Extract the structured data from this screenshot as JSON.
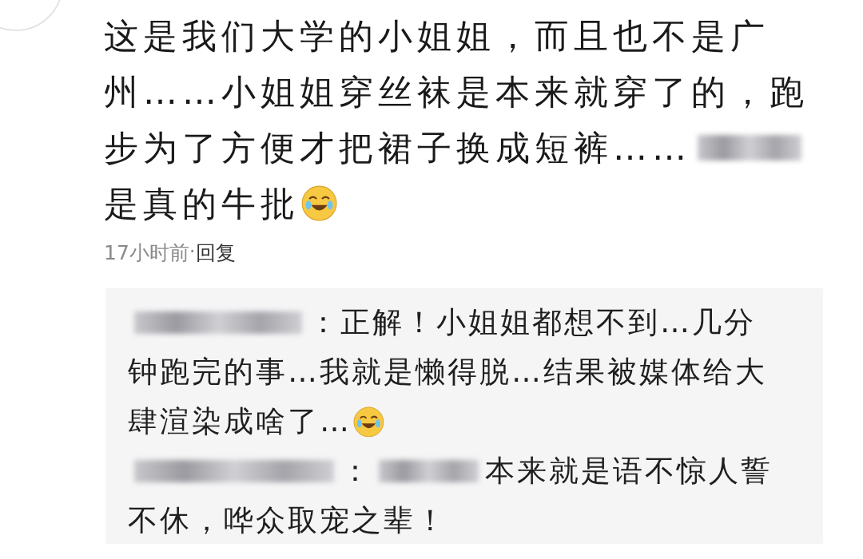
{
  "comment": {
    "lines": [
      [
        {
          "kind": "text",
          "text": "这是我们大学的小姐姐，而且也不是广"
        }
      ],
      [
        {
          "kind": "text",
          "text": "州……小姐姐穿丝袜是本来就穿了的，跑"
        }
      ],
      [
        {
          "kind": "text",
          "text": "步为了方便才把裙子换成短裤……"
        },
        {
          "kind": "redacted"
        }
      ],
      [
        {
          "kind": "text",
          "text": "是真的牛批"
        },
        {
          "kind": "emoji"
        }
      ]
    ],
    "time": "17小时前",
    "separator": "·",
    "reply_action": "回复"
  },
  "replies": [
    {
      "lines": [
        [
          {
            "kind": "redacted"
          },
          {
            "kind": "text",
            "text": "：正解！小姐姐都想不到…几分"
          }
        ],
        [
          {
            "kind": "text",
            "text": "钟跑完的事…我就是懒得脱…结果被媒体给大"
          }
        ],
        [
          {
            "kind": "text",
            "text": "肆渲染成啥了…"
          },
          {
            "kind": "emoji"
          }
        ]
      ]
    },
    {
      "lines": [
        [
          {
            "kind": "redacted"
          },
          {
            "kind": "text",
            "text": "："
          },
          {
            "kind": "redacted"
          },
          {
            "kind": "text",
            "text": "本来就是语不惊人誓"
          }
        ],
        [
          {
            "kind": "text",
            "text": "不休，哗众取宠之辈！"
          }
        ]
      ]
    }
  ]
}
